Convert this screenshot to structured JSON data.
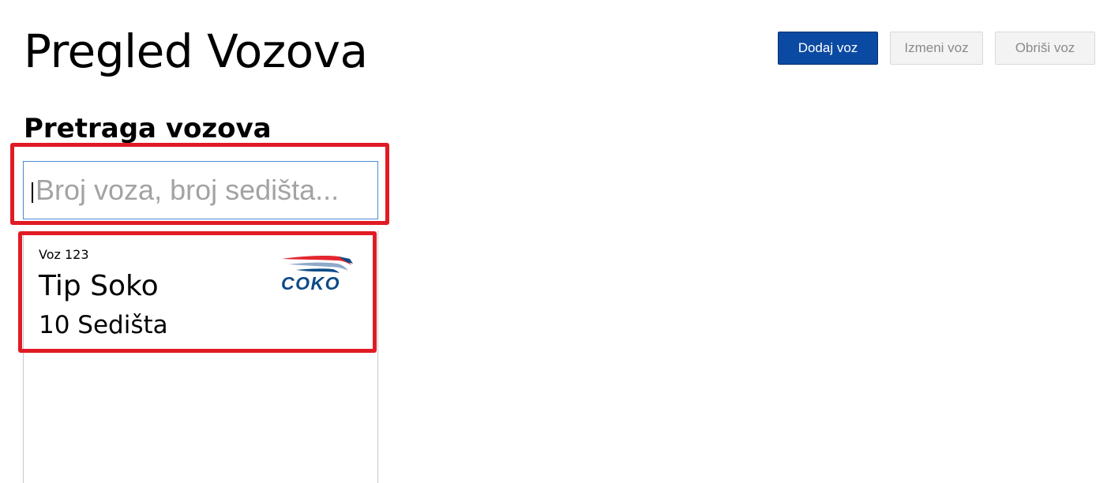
{
  "header": {
    "title": "Pregled Vozova"
  },
  "toolbar": {
    "add_label": "Dodaj voz",
    "edit_label": "Izmeni voz",
    "delete_label": "Obriši voz"
  },
  "search": {
    "section_title": "Pretraga vozova",
    "value": "",
    "placeholder": "Broj voza, broj sedišta..."
  },
  "trains": [
    {
      "number_label": "Voz 123",
      "type_label": "Tip Soko",
      "seats_label": "10 Sedišta",
      "logo_text": "COKO"
    }
  ],
  "colors": {
    "primary_button": "#0b4aa2",
    "highlight": "#e01b24",
    "logo_blue": "#0d4a86",
    "logo_red": "#e3262f"
  }
}
